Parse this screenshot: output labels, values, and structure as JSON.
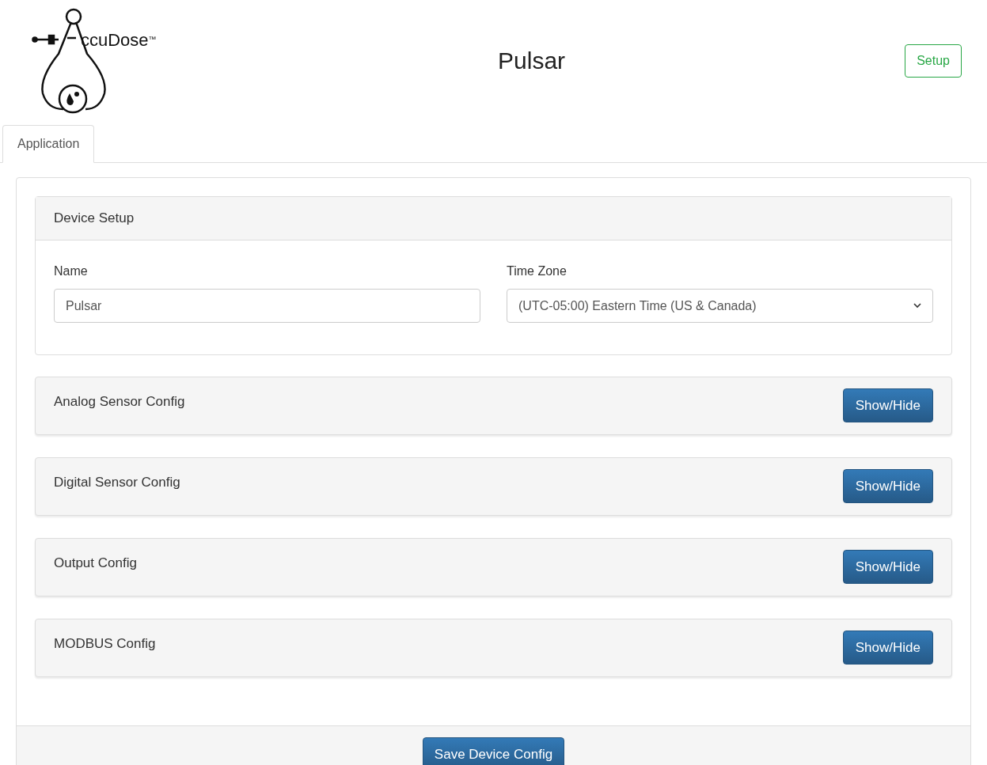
{
  "logo": {
    "text": "ccuDose",
    "mark": "™"
  },
  "title": "Pulsar",
  "setup_button": "Setup",
  "tabs": [
    {
      "label": "Application",
      "selected": true
    }
  ],
  "device_setup": {
    "title": "Device Setup",
    "fields": [
      {
        "kind": "input",
        "label": "Name",
        "value": "Pulsar"
      },
      {
        "kind": "select",
        "label": "Time Zone",
        "value": "(UTC-05:00) Eastern Time (US & Canada)"
      }
    ]
  },
  "sections": [
    {
      "title": "Analog Sensor Config",
      "button": "Show/Hide"
    },
    {
      "title": "Digital Sensor Config",
      "button": "Show/Hide"
    },
    {
      "title": "Output Config",
      "button": "Show/Hide"
    },
    {
      "title": "MODBUS Config",
      "button": "Show/Hide"
    }
  ],
  "save_button": "Save Device Config"
}
